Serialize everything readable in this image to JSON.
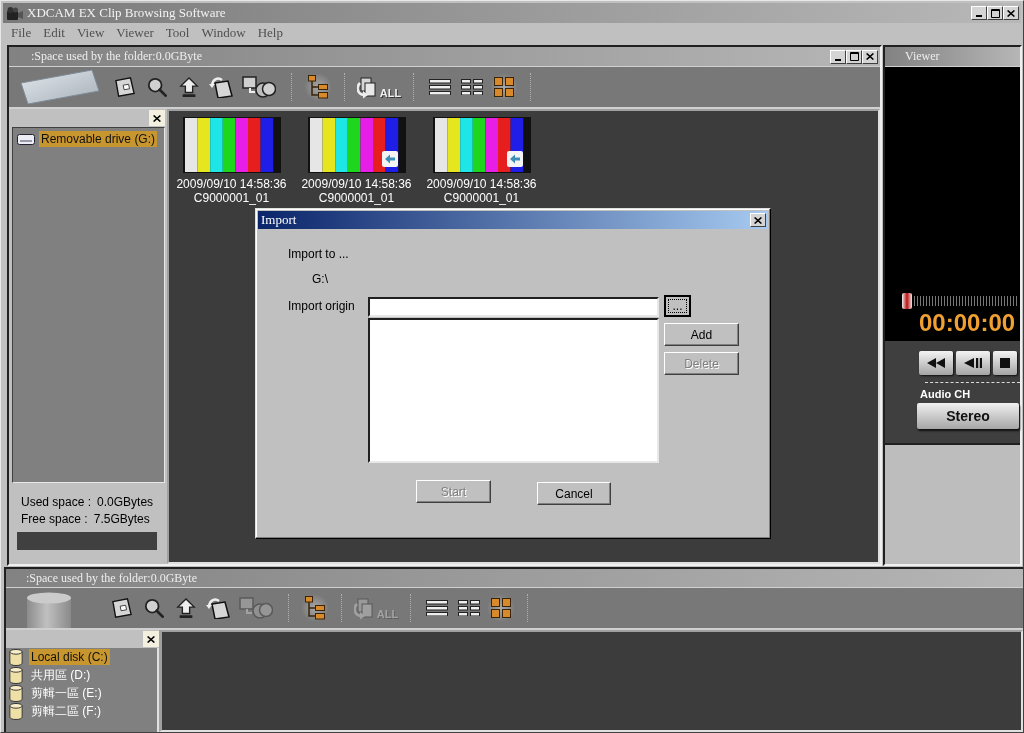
{
  "window": {
    "title": "XDCAM EX Clip Browsing Software"
  },
  "menu": [
    "File",
    "Edit",
    "View",
    "Viewer",
    "Tool",
    "Window",
    "Help"
  ],
  "upper_pane": {
    "title": ":Space used by the folder:0.0GByte",
    "drive_art": {
      "kind": "card"
    },
    "toolbar": {
      "tools": [
        {
          "kind": "folder",
          "disabled": false
        },
        {
          "kind": "search",
          "disabled": false
        },
        {
          "kind": "up",
          "disabled": false
        },
        {
          "kind": "return",
          "disabled": false
        },
        {
          "kind": "chain",
          "disabled": false
        }
      ],
      "tree": {
        "on": true
      },
      "import_all": {
        "label": "ALL",
        "disabled": false
      },
      "views": [
        {
          "kind": "list",
          "selected": false
        },
        {
          "kind": "details",
          "selected": false
        },
        {
          "kind": "thumbnails",
          "selected": true
        }
      ]
    },
    "drives": [
      {
        "kind": "removable",
        "label": "Removable drive (G:)",
        "selected": true
      }
    ],
    "used_space": {
      "label": "Used space :",
      "value": "0.0GBytes"
    },
    "free_space": {
      "label": "Free space :",
      "value": "7.5GBytes"
    },
    "clips": [
      {
        "time": "2009/09/10 14:58:36",
        "name": "C9000001_01",
        "arrow_badge": false
      },
      {
        "time": "2009/09/10 14:58:36",
        "name": "C9000001_01",
        "arrow_badge": true
      },
      {
        "time": "2009/09/10 14:58:36",
        "name": "C9000001_01",
        "arrow_badge": true
      }
    ]
  },
  "viewer": {
    "title": "Viewer",
    "position": {
      "level": 0
    },
    "timecode": "00:00:00",
    "transport": [
      {
        "kind": "rewind"
      },
      {
        "kind": "step-back"
      },
      {
        "kind": "stop"
      }
    ],
    "audio_label": "Audio CH",
    "audio_mode": "Stereo"
  },
  "lower_pane": {
    "title": ":Space used by the folder:0.0GByte",
    "drive_art": {
      "kind": "disk"
    },
    "toolbar": {
      "tools": [
        {
          "kind": "folder",
          "disabled": false
        },
        {
          "kind": "search",
          "disabled": false
        },
        {
          "kind": "up",
          "disabled": false
        },
        {
          "kind": "return",
          "disabled": false
        },
        {
          "kind": "chain",
          "disabled": true
        }
      ],
      "tree": {
        "on": true
      },
      "import_all": {
        "label": "ALL",
        "disabled": true
      },
      "views": [
        {
          "kind": "list",
          "selected": false
        },
        {
          "kind": "details",
          "selected": false
        },
        {
          "kind": "thumbnails",
          "selected": true
        }
      ]
    },
    "drives": [
      {
        "kind": "disk",
        "label": "Local disk (C:)",
        "selected": true
      },
      {
        "kind": "disk",
        "label": "共用區 (D:)",
        "selected": false
      },
      {
        "kind": "disk",
        "label": "剪輯一區 (E:)",
        "selected": false
      },
      {
        "kind": "disk",
        "label": "剪輯二區 (F:)",
        "selected": false
      }
    ]
  },
  "import_dialog": {
    "title": "Import",
    "target_label": "Import to ...",
    "target_path": "G:\\",
    "origin_label": "Import origin",
    "browse_button": {
      "label": "..."
    },
    "add_button": {
      "label": "Add",
      "disabled": false
    },
    "delete_button": {
      "label": "Delete",
      "disabled": true
    },
    "start_button": {
      "label": "Start",
      "disabled": true
    },
    "cancel_button": {
      "label": "Cancel",
      "disabled": false
    }
  }
}
